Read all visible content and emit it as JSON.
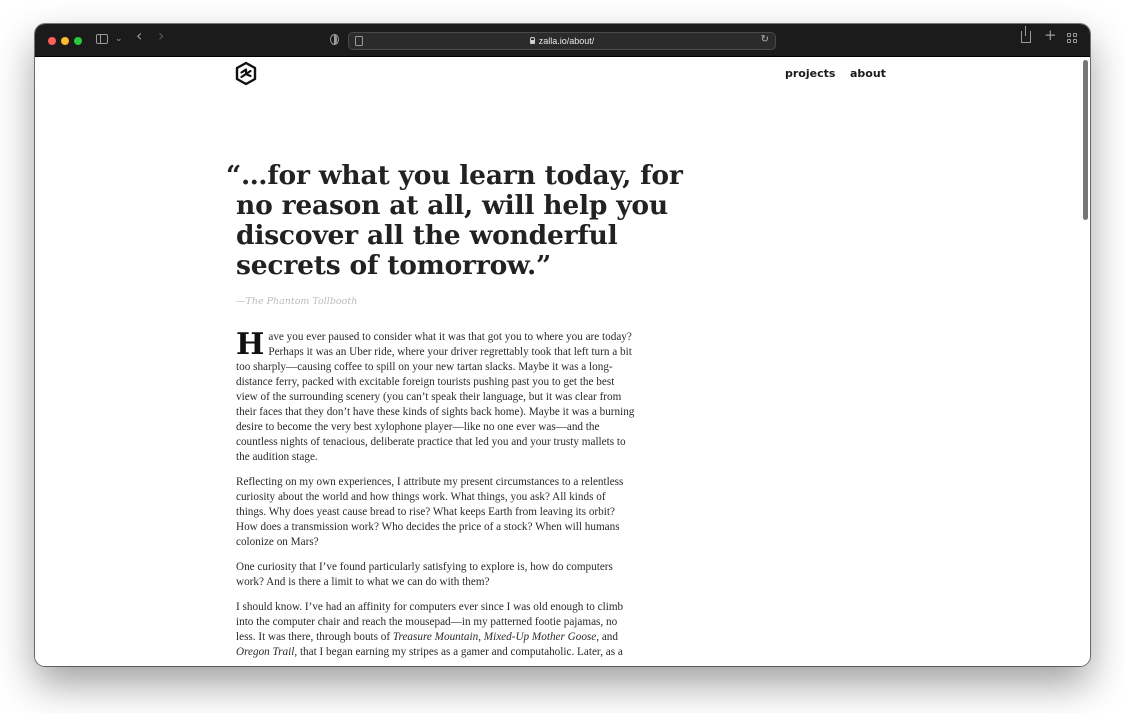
{
  "browser": {
    "url": "zalla.io/about/",
    "icons": {
      "traffic_lights": [
        "close",
        "minimize",
        "zoom"
      ],
      "toolbar": [
        "sidebar-icon",
        "chevron-down-icon",
        "back-icon",
        "forward-icon",
        "shield-icon",
        "page-icon",
        "lock-icon",
        "reload-icon",
        "share-icon",
        "new-tab-icon",
        "tab-overview-icon"
      ]
    },
    "colors": {
      "titlebar": "#1b1b1b",
      "red": "#ff5f57",
      "yellow": "#febc2e",
      "green": "#28c840"
    }
  },
  "site": {
    "logo_icon": "zalla-logo-icon",
    "nav": {
      "projects": "projects",
      "about": "about"
    }
  },
  "article": {
    "quote_lines": [
      "“…for what you learn today, for",
      "no reason at all, will help you",
      "discover all the wonderful",
      "secrets of tomorrow.”"
    ],
    "attribution": "—The Phantom Tollbooth",
    "dropcap": "H",
    "p1_lines": [
      "ave you ever paused to consider what it was that got you to where you are today?",
      "Perhaps it was an Uber ride, where your driver regrettably took that left turn a bit",
      "too sharply—causing coffee to spill on your new tartan slacks. Maybe it was a long-",
      "distance ferry, packed with excitable foreign tourists pushing past you to get the best",
      "view of the surrounding scenery (you can’t speak their language, but it was clear from",
      "their faces that they don’t have these kinds of sights back home). Maybe it was a burning",
      "desire to become the very best xylophone player—like no one ever was—and the",
      "countless nights of tenacious, deliberate practice that led you and your trusty mallets to",
      "the audition stage."
    ],
    "p2_lines": [
      "Reflecting on my own experiences, I attribute my present circumstances to a relentless",
      "curiosity about the world and how things work. What things, you ask? All kinds of",
      "things. Why does yeast cause bread to rise? What keeps Earth from leaving its orbit?",
      "How does a transmission work? Who decides the price of a stock? When will humans",
      "colonize on Mars?"
    ],
    "p3_lines": [
      "One curiosity that I’ve found particularly satisfying to explore is, how do computers",
      "work? And is there a limit to what we can do with them?"
    ],
    "p4": {
      "l1": "I should know. I’ve had an affinity for computers ever since I was old enough to climb",
      "l2": "into the computer chair and reach the mousepad—in my patterned footie pajamas, no",
      "l3_pre": "less. It was there, through bouts of ",
      "l3_em1": "Treasure Mountain",
      "l3_mid": ", ",
      "l3_em2": "Mixed-Up Mother Goose",
      "l3_post": ", and",
      "l4_em": "Oregon Trail",
      "l4_post": ", that I began earning my stripes as a gamer and computaholic. Later, as a"
    }
  }
}
